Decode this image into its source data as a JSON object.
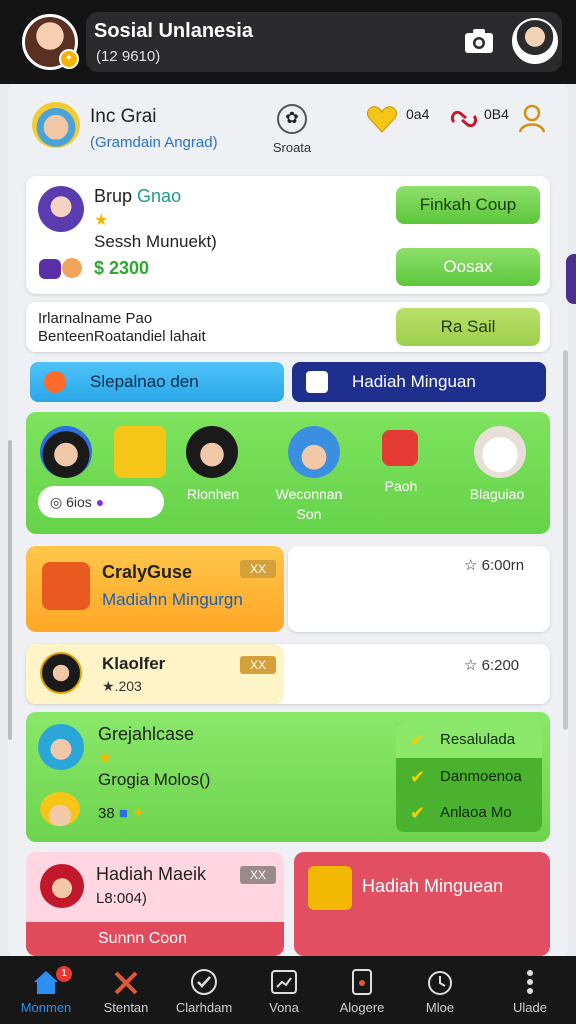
{
  "header": {
    "title": "Sosial Unlanesia",
    "subtitle": "(12 9610)",
    "camera_icon": "camera-icon"
  },
  "profile": {
    "name": "Inc Grai",
    "subtitle": "(Gramdain Angrad)",
    "mid_label": "Sroata",
    "stat1": "0a4",
    "stat2": "0B4"
  },
  "group_card": {
    "title_a": "Brup",
    "title_b": "Gnao",
    "subtitle": "Sessh Munuekt)",
    "price": "$ 2300",
    "btn1": "Finkah Coup",
    "btn2": "Oosax"
  },
  "info_card": {
    "line1": "Irlarnalname Pao",
    "line2": "BenteenRoatandiel lahait",
    "btn": "Ra Sail"
  },
  "pills": {
    "left": "Slepalnao den",
    "right": "Hadiah Minguan"
  },
  "strip": {
    "pill_text": "6ios",
    "labels": [
      "Rlonhen",
      "Weconnan\nSon",
      "Paoh",
      "Blaguiao"
    ]
  },
  "orange_card": {
    "title": "CralyGuse",
    "subtitle": "Madiahn Mingurgn",
    "tag": "XX",
    "stat": "☆ 6:00rn"
  },
  "yellow_card": {
    "title": "Klaolfer",
    "subtitle": "★.203",
    "tag": "XX",
    "stat": "☆ 6:200"
  },
  "green_card": {
    "title": "Grejahlcase",
    "subtitle": "Grogia Molos()",
    "meta": "38",
    "list": [
      "Resalulada",
      "Danmoenoa",
      "Anlaoa Mo"
    ]
  },
  "pink_card": {
    "title": "Hadiah Maeik",
    "subtitle": "L8:004)",
    "tag": "XX",
    "bar": "Sunnn Coon"
  },
  "red_card": {
    "title": "Hadiah Minguean"
  },
  "nav": [
    {
      "label": "Monmen",
      "badge": "1",
      "icon": "home-icon"
    },
    {
      "label": "Stentan",
      "icon": "tools-icon"
    },
    {
      "label": "Clarhdam",
      "icon": "check-circle-icon"
    },
    {
      "label": "Vona",
      "icon": "chart-icon"
    },
    {
      "label": "Alogere",
      "icon": "phone-icon"
    },
    {
      "label": "Mloe",
      "icon": "clock-icon"
    },
    {
      "label": "Ulade",
      "icon": "menu-icon"
    }
  ]
}
